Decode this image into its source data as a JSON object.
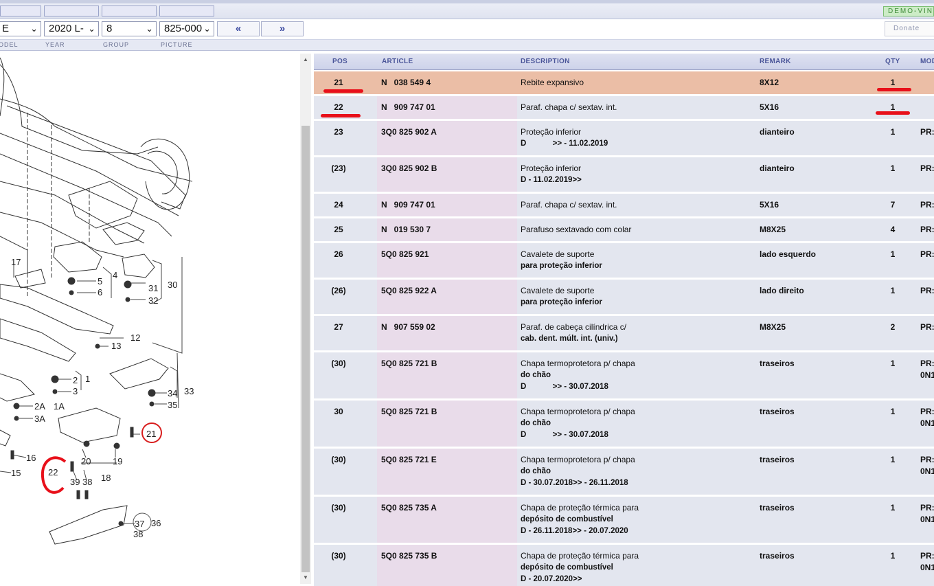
{
  "tabs": {
    "demo_label": "DEMO-VIN"
  },
  "selectors": {
    "model": "E",
    "year": "2020  L-",
    "group": "8",
    "picture": "825-000"
  },
  "nav": {
    "prev": "«",
    "next": "»",
    "donate": "Donate"
  },
  "labels": {
    "model": "ODEL",
    "year": "YEAR",
    "group": "GROUP",
    "picture": "PICTURE"
  },
  "table": {
    "headers": {
      "pos": "POS",
      "article": "ARTICLE",
      "description": "DESCRIPTION",
      "remark": "REMARK",
      "qty": "QTY",
      "model": "MOD"
    },
    "rows": [
      {
        "pos": "21",
        "article": "N   038 549 4",
        "desc1": "Rebite expansivo",
        "desc2": "",
        "desc3": "",
        "remark": "8X12",
        "qty": "1",
        "model": "",
        "highlight": true
      },
      {
        "pos": "22",
        "article": "N   909 747 01",
        "desc1": "Paraf. chapa c/ sextav. int.",
        "desc2": "",
        "desc3": "",
        "remark": "5X16",
        "qty": "1",
        "model": ""
      },
      {
        "pos": "23",
        "article": "3Q0 825 902 A",
        "desc1": "Proteção inferior",
        "desc2": "D            >> - 11.02.2019",
        "desc3": "",
        "remark": "dianteiro",
        "qty": "1",
        "model": "PR:"
      },
      {
        "pos": "(23)",
        "article": "3Q0 825 902 B",
        "desc1": "Proteção inferior",
        "desc2": "D - 11.02.2019>>",
        "desc3": "",
        "remark": "dianteiro",
        "qty": "1",
        "model": "PR:"
      },
      {
        "pos": "24",
        "article": "N   909 747 01",
        "desc1": "Paraf. chapa c/ sextav. int.",
        "desc2": "",
        "desc3": "",
        "remark": "5X16",
        "qty": "7",
        "model": "PR:"
      },
      {
        "pos": "25",
        "article": "N   019 530 7",
        "desc1": "Parafuso sextavado com colar",
        "desc2": "",
        "desc3": "",
        "remark": "M8X25",
        "qty": "4",
        "model": "PR:"
      },
      {
        "pos": "26",
        "article": "5Q0 825 921",
        "desc1": "Cavalete de suporte",
        "desc2": "para proteção inferior",
        "desc3": "",
        "remark": "lado esquerdo",
        "qty": "1",
        "model": "PR:"
      },
      {
        "pos": "(26)",
        "article": "5Q0 825 922 A",
        "desc1": "Cavalete de suporte",
        "desc2": "para proteção inferior",
        "desc3": "",
        "remark": "lado direito",
        "qty": "1",
        "model": "PR:"
      },
      {
        "pos": "27",
        "article": "N   907 559 02",
        "desc1": "Paraf. de cabeça cilíndrica c/",
        "desc2": "cab. dent. múlt. int. (univ.)",
        "desc3": "",
        "remark": "M8X25",
        "qty": "2",
        "model": "PR:"
      },
      {
        "pos": "(30)",
        "article": "5Q0 825 721 B",
        "desc1": "Chapa termoprotetora p/ chapa",
        "desc2": "do chão",
        "desc3": "D            >> - 30.07.2018",
        "remark": "traseiros",
        "qty": "1",
        "model": "PR:\n0N1"
      },
      {
        "pos": "30",
        "article": "5Q0 825 721 B",
        "desc1": "Chapa termoprotetora p/ chapa",
        "desc2": "do chão",
        "desc3": "D            >> - 30.07.2018",
        "remark": "traseiros",
        "qty": "1",
        "model": "PR:\n0N1"
      },
      {
        "pos": "(30)",
        "article": "5Q0 825 721 E",
        "desc1": "Chapa termoprotetora p/ chapa",
        "desc2": "do chão",
        "desc3": "D - 30.07.2018>> - 26.11.2018",
        "remark": "traseiros",
        "qty": "1",
        "model": "PR:\n0N1"
      },
      {
        "pos": "(30)",
        "article": "5Q0 825 735 A",
        "desc1": "Chapa de proteção térmica para",
        "desc2": "depósito de combustível",
        "desc3": "D - 26.11.2018>> - 20.07.2020",
        "remark": "traseiros",
        "qty": "1",
        "model": "PR:\n0N1"
      },
      {
        "pos": "(30)",
        "article": "5Q0 825 735 B",
        "desc1": "Chapa de proteção térmica para",
        "desc2": "depósito de combustível",
        "desc3": "D - 20.07.2020>>",
        "remark": "traseiros",
        "qty": "1",
        "model": "PR:\n0N1"
      }
    ]
  },
  "diagram_callouts": [
    "17",
    "5",
    "6",
    "4",
    "31",
    "32",
    "30",
    "12",
    "13",
    "2",
    "1",
    "3",
    "2A",
    "1A",
    "3A",
    "34",
    "35",
    "33",
    "21",
    "16",
    "15",
    "22",
    "20",
    "19",
    "18",
    "39",
    "38",
    "37",
    "38",
    "36"
  ],
  "colors": {
    "highlight_row": "#ebbea6",
    "annotation_red": "#e8101a",
    "header_text": "#4a5599"
  }
}
